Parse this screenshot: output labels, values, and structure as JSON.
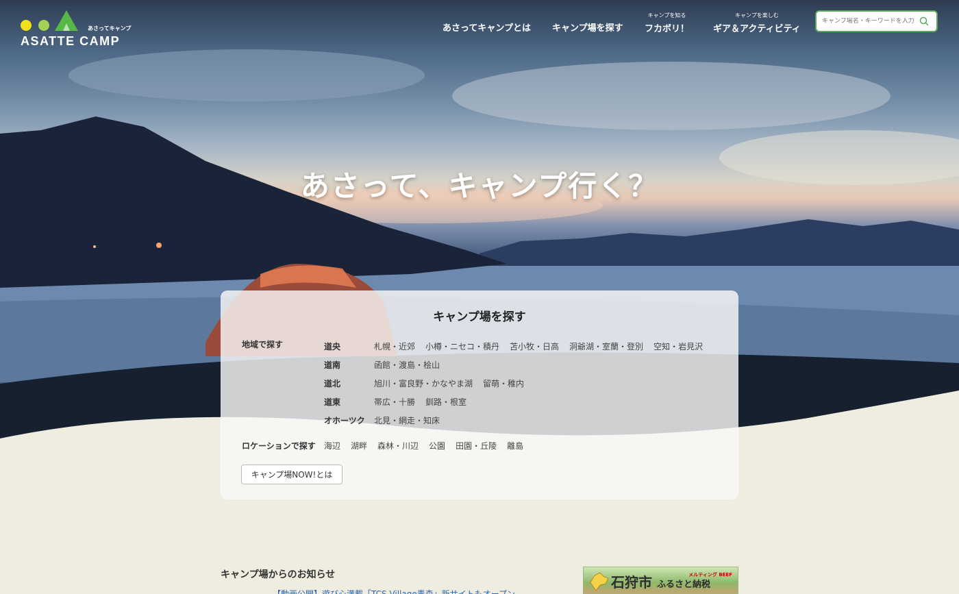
{
  "header": {
    "logo_text": "ASATTE CAMP",
    "logo_sub": "あさってキャンプ",
    "nav": [
      {
        "label": "あさってキャンプとは",
        "sub": ""
      },
      {
        "label": "キャンプ場を探す",
        "sub": ""
      },
      {
        "label": "フカボリ！",
        "sub": "キャンプを知る"
      },
      {
        "label": "ギア＆アクティビティ",
        "sub": "キャンプを楽しむ"
      }
    ],
    "search_placeholder": "キャンプ場名・キーワードを入力"
  },
  "hero": {
    "title": "あさって、キャンプ行く？"
  },
  "panel": {
    "title": "キャンプ場を探す",
    "region_label": "地域で探す",
    "regions": [
      {
        "name": "道央",
        "links": [
          "札幌・近郊",
          "小樽・ニセコ・積丹",
          "苫小牧・日高",
          "洞爺湖・室蘭・登別",
          "空知・岩見沢"
        ]
      },
      {
        "name": "道南",
        "links": [
          "函館・渡島・桧山"
        ]
      },
      {
        "name": "道北",
        "links": [
          "旭川・富良野・かなやま湖",
          "留萌・稚内"
        ]
      },
      {
        "name": "道東",
        "links": [
          "帯広・十勝",
          "釧路・根室"
        ]
      },
      {
        "name": "オホーツク",
        "links": [
          "北見・網走・知床"
        ]
      }
    ],
    "location_label": "ロケーションで探す",
    "locations": [
      "海辺",
      "湖畔",
      "森林・川辺",
      "公園",
      "田園・丘陵",
      "離島"
    ],
    "about_button": "キャンプ場NOW!とは"
  },
  "news": {
    "title": "キャンプ場からのお知らせ",
    "item": "【動画公開】遊び心満載「TCS Village青森」新サイトもオープン"
  },
  "banner": {
    "city": "石狩市",
    "text": "ふるさと納税",
    "badge": "メルティング BEEF"
  },
  "colors": {
    "accent_green": "#5ba85b",
    "logo_yellow": "#f2e21a",
    "logo_green_light": "#a6cf55",
    "logo_green": "#57b847",
    "cream": "#efede0"
  }
}
